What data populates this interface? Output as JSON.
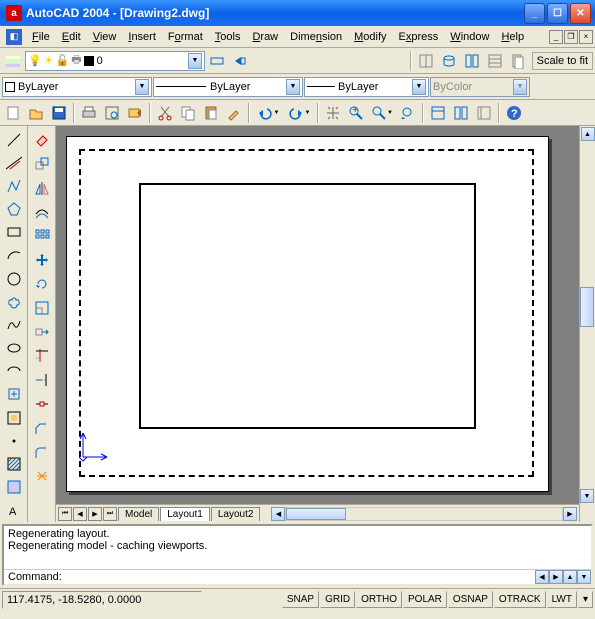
{
  "title": "AutoCAD 2004 - [Drawing2.dwg]",
  "app_icon_letter": "a",
  "menu": {
    "file": "File",
    "edit": "Edit",
    "view": "View",
    "insert": "Insert",
    "format": "Format",
    "tools": "Tools",
    "draw": "Draw",
    "dimension": "Dimension",
    "modify": "Modify",
    "express": "Express",
    "window": "Window",
    "help": "Help"
  },
  "layer_combo": "0",
  "linetype": "ByLayer",
  "lineweight": "ByLayer",
  "plotstyle": "ByColor",
  "scale_btn": "Scale to fit",
  "tabs": {
    "model": "Model",
    "layout1": "Layout1",
    "layout2": "Layout2"
  },
  "cmd_history": "Regenerating layout.\nRegenerating model - caching viewports.",
  "cmd_prompt": "Command:",
  "cmd_value": "",
  "status_coords": "117.4175, -18.5280, 0.0000",
  "status_toggles": {
    "snap": "SNAP",
    "grid": "GRID",
    "ortho": "ORTHO",
    "polar": "POLAR",
    "osnap": "OSNAP",
    "otrack": "OTRACK",
    "lwt": "LWT"
  }
}
